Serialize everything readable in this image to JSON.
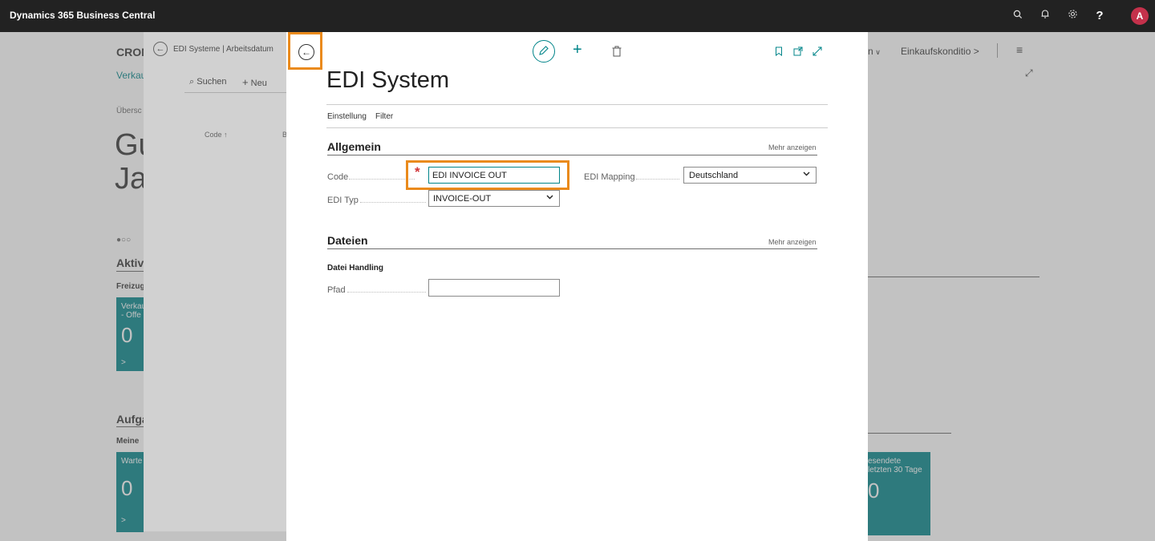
{
  "app": {
    "title": "Dynamics 365 Business Central",
    "avatar_letter": "A",
    "accent": "#008489",
    "highlight": "#ea8a1c"
  },
  "topbar_icons": [
    "search-icon",
    "bell-icon",
    "gear-icon",
    "help-icon"
  ],
  "background_page": {
    "company": "CRON",
    "nav_item": "Verkau",
    "section_small": "Übersc",
    "greeting_line1": "Gu",
    "greeting_line2": "Ja",
    "activities": "Aktivi",
    "freizug": "Freizug",
    "tile1_label1": "Verkau",
    "tile1_label2": "- Offe",
    "tile1_value": "0",
    "aufgaben": "Aufga",
    "meine": "Meine",
    "tile2_label": "Warte",
    "tile2_value": "0",
    "right_nav1": "n",
    "right_nav2": "Einkaufskonditio",
    "right_tile_label1": "esendete",
    "right_tile_label2": "letzten 30 Tage",
    "right_tile_value": "0"
  },
  "list_panel": {
    "breadcrumb": "EDI Systeme | Arbeitsdatum",
    "search_label": "Suchen",
    "new_label": "Neu",
    "column_code": "Code ↑",
    "column_b": "B"
  },
  "dialog": {
    "title": "EDI System",
    "tabs": [
      "Einstellung",
      "Filter"
    ],
    "section_general": "Allgemein",
    "show_more": "Mehr anzeigen",
    "code_label": "Code",
    "code_value": "EDI INVOICE OUT",
    "required_mark": "*",
    "edi_typ_label": "EDI Typ",
    "edi_typ_value": "INVOICE-OUT",
    "edi_mapping_label": "EDI Mapping",
    "edi_mapping_value": "Deutschland",
    "section_files": "Dateien",
    "show_more_files": "Mehr anzeigen",
    "file_handling": "Datei Handling",
    "path_label": "Pfad",
    "path_value": ""
  }
}
